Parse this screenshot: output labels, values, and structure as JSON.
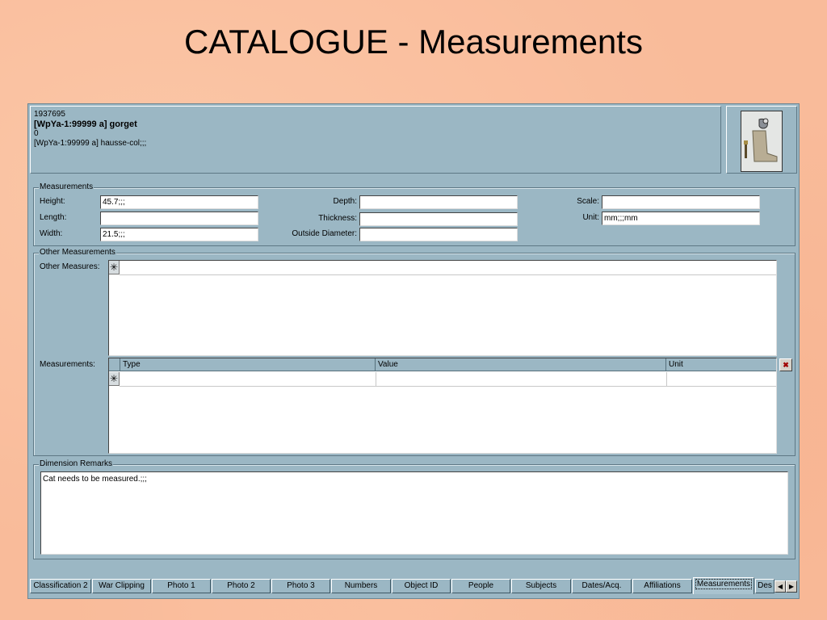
{
  "slide_title": "CATALOGUE - Measurements",
  "header": {
    "line1": "1937695",
    "line2": "[WpYa-1:99999 a] gorget",
    "line3": "0",
    "line4": "[WpYa-1:99999 a] hausse-col;;;"
  },
  "measurements": {
    "legend": "Measurements",
    "height_label": "Height:",
    "height_value": "45.7;;;",
    "length_label": "Length:",
    "length_value": "",
    "width_label": "Width:",
    "width_value": "21.5;;;",
    "depth_label": "Depth:",
    "depth_value": "",
    "thickness_label": "Thickness:",
    "thickness_value": "",
    "outside_diameter_label": "Outside Diameter:",
    "outside_diameter_value": "",
    "scale_label": "Scale:",
    "scale_value": "",
    "unit_label": "Unit:",
    "unit_value": "mm;;;mm"
  },
  "other_measurements": {
    "legend": "Other Measurements",
    "other_measures_label": "Other Measures:",
    "new_row_marker": "✳",
    "measurements_label": "Measurements:",
    "columns": [
      "Type",
      "Value",
      "Unit"
    ]
  },
  "dimension_remarks": {
    "legend": "Dimension Remarks",
    "text": "Cat needs to be measured.;;;"
  },
  "tabs": [
    {
      "label": "Classification 2"
    },
    {
      "label": "War Clipping"
    },
    {
      "label": "Photo 1"
    },
    {
      "label": "Photo 2"
    },
    {
      "label": "Photo 3"
    },
    {
      "label": "Numbers"
    },
    {
      "label": "Object ID"
    },
    {
      "label": "People"
    },
    {
      "label": "Subjects"
    },
    {
      "label": "Dates/Acq."
    },
    {
      "label": "Affiliations"
    },
    {
      "label": "Measurements"
    },
    {
      "label": "Des"
    }
  ],
  "active_tab": "Measurements",
  "icons": {
    "tab_left": "◀",
    "tab_right": "▶",
    "row_delete": "✖"
  }
}
